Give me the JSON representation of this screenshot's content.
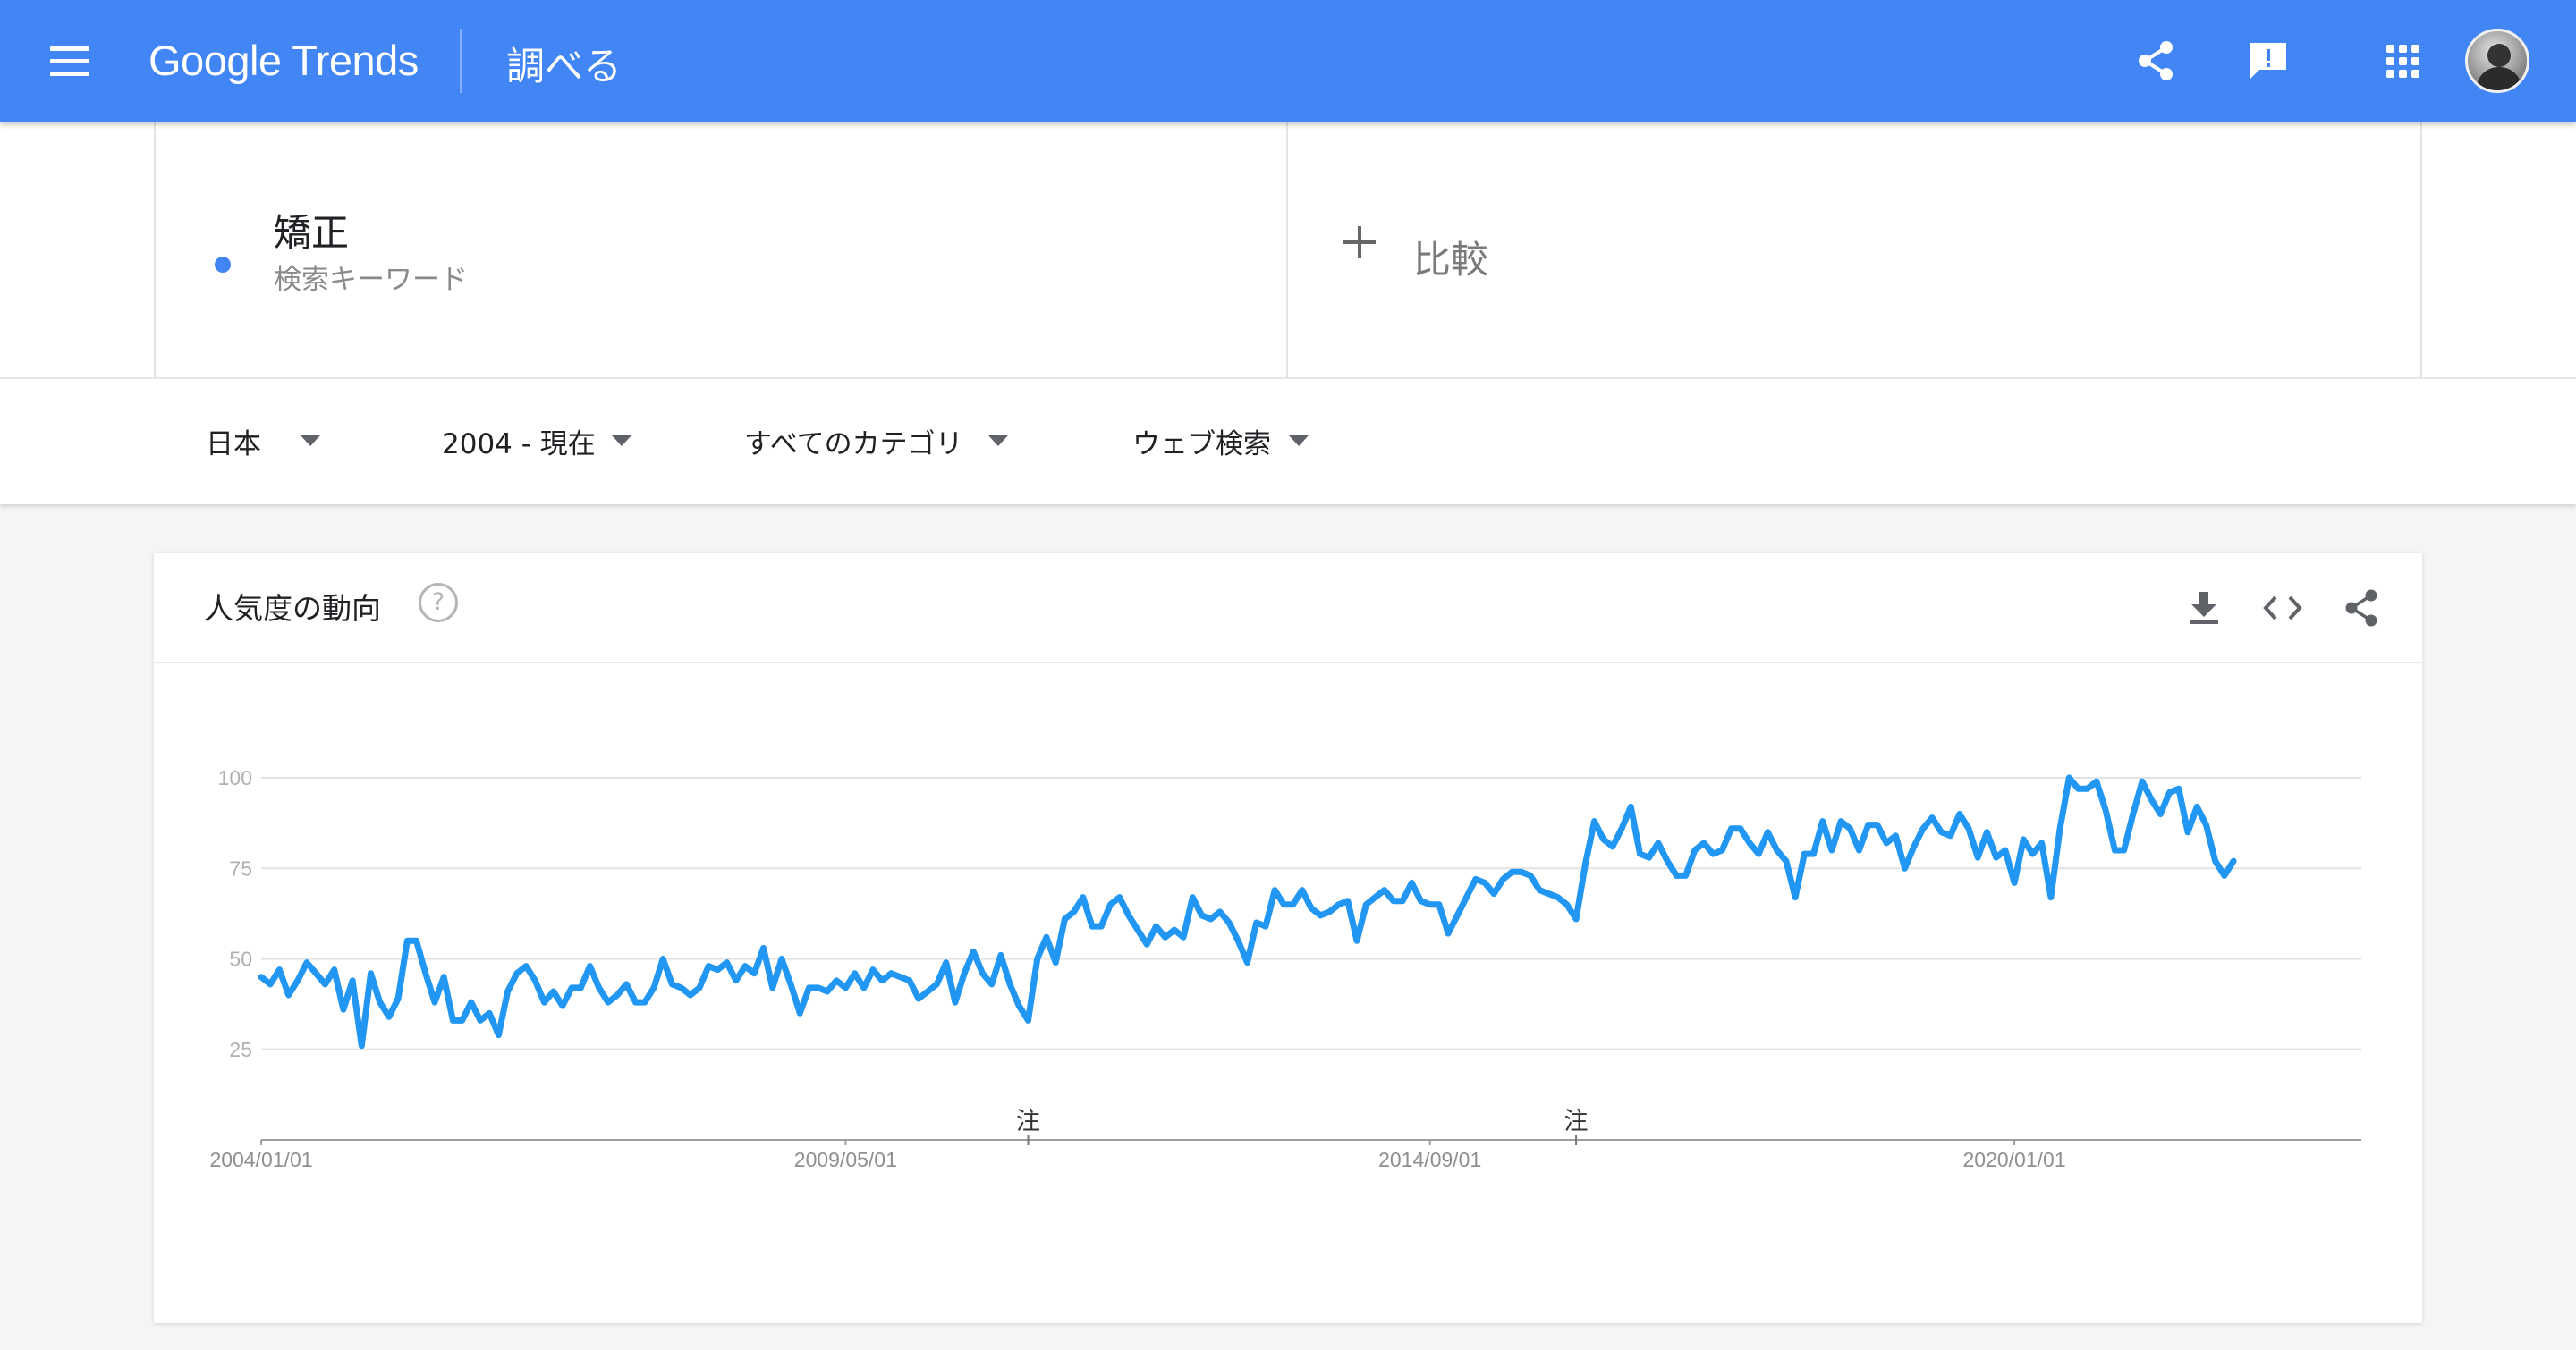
{
  "header": {
    "logo_text": "Google Trends",
    "page_title": "調べる",
    "icons": [
      "menu-icon",
      "share-icon",
      "feedback-icon",
      "apps-icon",
      "account-avatar"
    ],
    "brand_color": "#4285f4"
  },
  "term": {
    "name": "矯正",
    "type": "検索キーワード",
    "color": "#4285f4"
  },
  "compare": {
    "label": "比較"
  },
  "filters": {
    "region": "日本",
    "period": "2004 - 現在",
    "category": "すべてのカテゴリ",
    "search_type": "ウェブ検索"
  },
  "chart_card": {
    "title": "人気度の動向",
    "help_glyph": "?",
    "icons": [
      "download-icon",
      "embed-icon",
      "share-icon"
    ]
  },
  "chart_data": {
    "type": "line",
    "title": "",
    "xlabel": "",
    "ylabel": "",
    "ylim": [
      0,
      100
    ],
    "y_ticks": [
      "100",
      "75",
      "50",
      "25"
    ],
    "x_tick_labels": [
      "2004/01/01",
      "2009/05/01",
      "2014/09/01",
      "2020/01/01"
    ],
    "x_range": [
      "2004-01",
      "2023-03"
    ],
    "annotations": [
      {
        "label": "注",
        "date": "2011-01"
      },
      {
        "label": "注",
        "date": "2016-01"
      }
    ],
    "grid": true,
    "legend": "none",
    "series": [
      {
        "color": "#2196f3",
        "points": [
          [
            "2004-01",
            45
          ],
          [
            "2004-02",
            43
          ],
          [
            "2004-03",
            47
          ],
          [
            "2004-04",
            40
          ],
          [
            "2004-05",
            44
          ],
          [
            "2004-06",
            49
          ],
          [
            "2004-07",
            46
          ],
          [
            "2004-08",
            43
          ],
          [
            "2004-09",
            47
          ],
          [
            "2004-10",
            36
          ],
          [
            "2004-11",
            44
          ],
          [
            "2004-12",
            26
          ],
          [
            "2005-01",
            46
          ],
          [
            "2005-02",
            38
          ],
          [
            "2005-03",
            34
          ],
          [
            "2005-04",
            39
          ],
          [
            "2005-05",
            55
          ],
          [
            "2005-06",
            55
          ],
          [
            "2005-07",
            46
          ],
          [
            "2005-08",
            38
          ],
          [
            "2005-09",
            45
          ],
          [
            "2005-10",
            33
          ],
          [
            "2005-11",
            33
          ],
          [
            "2005-12",
            38
          ],
          [
            "2006-01",
            33
          ],
          [
            "2006-02",
            35
          ],
          [
            "2006-03",
            29
          ],
          [
            "2006-04",
            41
          ],
          [
            "2006-05",
            46
          ],
          [
            "2006-06",
            48
          ],
          [
            "2006-07",
            44
          ],
          [
            "2006-08",
            38
          ],
          [
            "2006-09",
            41
          ],
          [
            "2006-10",
            37
          ],
          [
            "2006-11",
            42
          ],
          [
            "2006-12",
            42
          ],
          [
            "2007-01",
            48
          ],
          [
            "2007-02",
            42
          ],
          [
            "2007-03",
            38
          ],
          [
            "2007-04",
            40
          ],
          [
            "2007-05",
            43
          ],
          [
            "2007-06",
            38
          ],
          [
            "2007-07",
            38
          ],
          [
            "2007-08",
            42
          ],
          [
            "2007-09",
            50
          ],
          [
            "2007-10",
            43
          ],
          [
            "2007-11",
            42
          ],
          [
            "2007-12",
            40
          ],
          [
            "2008-01",
            42
          ],
          [
            "2008-02",
            48
          ],
          [
            "2008-03",
            47
          ],
          [
            "2008-04",
            49
          ],
          [
            "2008-05",
            44
          ],
          [
            "2008-06",
            48
          ],
          [
            "2008-07",
            46
          ],
          [
            "2008-08",
            53
          ],
          [
            "2008-09",
            42
          ],
          [
            "2008-10",
            50
          ],
          [
            "2008-11",
            43
          ],
          [
            "2008-12",
            35
          ],
          [
            "2009-01",
            42
          ],
          [
            "2009-02",
            42
          ],
          [
            "2009-03",
            41
          ],
          [
            "2009-04",
            44
          ],
          [
            "2009-05",
            42
          ],
          [
            "2009-06",
            46
          ],
          [
            "2009-07",
            42
          ],
          [
            "2009-08",
            47
          ],
          [
            "2009-09",
            44
          ],
          [
            "2009-10",
            46
          ],
          [
            "2009-11",
            45
          ],
          [
            "2009-12",
            44
          ],
          [
            "2010-01",
            39
          ],
          [
            "2010-02",
            41
          ],
          [
            "2010-03",
            43
          ],
          [
            "2010-04",
            49
          ],
          [
            "2010-05",
            38
          ],
          [
            "2010-06",
            46
          ],
          [
            "2010-07",
            52
          ],
          [
            "2010-08",
            46
          ],
          [
            "2010-09",
            43
          ],
          [
            "2010-10",
            51
          ],
          [
            "2010-11",
            43
          ],
          [
            "2010-12",
            37
          ],
          [
            "2011-01",
            33
          ],
          [
            "2011-02",
            50
          ],
          [
            "2011-03",
            56
          ],
          [
            "2011-04",
            49
          ],
          [
            "2011-05",
            61
          ],
          [
            "2011-06",
            63
          ],
          [
            "2011-07",
            67
          ],
          [
            "2011-08",
            59
          ],
          [
            "2011-09",
            59
          ],
          [
            "2011-10",
            65
          ],
          [
            "2011-11",
            67
          ],
          [
            "2011-12",
            62
          ],
          [
            "2012-01",
            58
          ],
          [
            "2012-02",
            54
          ],
          [
            "2012-03",
            59
          ],
          [
            "2012-04",
            56
          ],
          [
            "2012-05",
            58
          ],
          [
            "2012-06",
            56
          ],
          [
            "2012-07",
            67
          ],
          [
            "2012-08",
            62
          ],
          [
            "2012-09",
            61
          ],
          [
            "2012-10",
            63
          ],
          [
            "2012-11",
            60
          ],
          [
            "2012-12",
            55
          ],
          [
            "2013-01",
            49
          ],
          [
            "2013-02",
            60
          ],
          [
            "2013-03",
            59
          ],
          [
            "2013-04",
            69
          ],
          [
            "2013-05",
            65
          ],
          [
            "2013-06",
            65
          ],
          [
            "2013-07",
            69
          ],
          [
            "2013-08",
            64
          ],
          [
            "2013-09",
            62
          ],
          [
            "2013-10",
            63
          ],
          [
            "2013-11",
            65
          ],
          [
            "2013-12",
            66
          ],
          [
            "2014-01",
            55
          ],
          [
            "2014-02",
            65
          ],
          [
            "2014-03",
            67
          ],
          [
            "2014-04",
            69
          ],
          [
            "2014-05",
            66
          ],
          [
            "2014-06",
            66
          ],
          [
            "2014-07",
            71
          ],
          [
            "2014-08",
            66
          ],
          [
            "2014-09",
            65
          ],
          [
            "2014-10",
            65
          ],
          [
            "2014-11",
            57
          ],
          [
            "2014-12",
            62
          ],
          [
            "2015-01",
            67
          ],
          [
            "2015-02",
            72
          ],
          [
            "2015-03",
            71
          ],
          [
            "2015-04",
            68
          ],
          [
            "2015-05",
            72
          ],
          [
            "2015-06",
            74
          ],
          [
            "2015-07",
            74
          ],
          [
            "2015-08",
            73
          ],
          [
            "2015-09",
            69
          ],
          [
            "2015-10",
            68
          ],
          [
            "2015-11",
            67
          ],
          [
            "2015-12",
            65
          ],
          [
            "2016-01",
            61
          ],
          [
            "2016-02",
            76
          ],
          [
            "2016-03",
            88
          ],
          [
            "2016-04",
            83
          ],
          [
            "2016-05",
            81
          ],
          [
            "2016-06",
            86
          ],
          [
            "2016-07",
            92
          ],
          [
            "2016-08",
            79
          ],
          [
            "2016-09",
            78
          ],
          [
            "2016-10",
            82
          ],
          [
            "2016-11",
            77
          ],
          [
            "2016-12",
            73
          ],
          [
            "2017-01",
            73
          ],
          [
            "2017-02",
            80
          ],
          [
            "2017-03",
            82
          ],
          [
            "2017-04",
            79
          ],
          [
            "2017-05",
            80
          ],
          [
            "2017-06",
            86
          ],
          [
            "2017-07",
            86
          ],
          [
            "2017-08",
            82
          ],
          [
            "2017-09",
            79
          ],
          [
            "2017-10",
            85
          ],
          [
            "2017-11",
            80
          ],
          [
            "2017-12",
            77
          ],
          [
            "2018-01",
            67
          ],
          [
            "2018-02",
            79
          ],
          [
            "2018-03",
            79
          ],
          [
            "2018-04",
            88
          ],
          [
            "2018-05",
            80
          ],
          [
            "2018-06",
            88
          ],
          [
            "2018-07",
            86
          ],
          [
            "2018-08",
            80
          ],
          [
            "2018-09",
            87
          ],
          [
            "2018-10",
            87
          ],
          [
            "2018-11",
            82
          ],
          [
            "2018-12",
            84
          ],
          [
            "2019-01",
            75
          ],
          [
            "2019-02",
            81
          ],
          [
            "2019-03",
            86
          ],
          [
            "2019-04",
            89
          ],
          [
            "2019-05",
            85
          ],
          [
            "2019-06",
            84
          ],
          [
            "2019-07",
            90
          ],
          [
            "2019-08",
            86
          ],
          [
            "2019-09",
            78
          ],
          [
            "2019-10",
            85
          ],
          [
            "2019-11",
            78
          ],
          [
            "2019-12",
            80
          ],
          [
            "2020-01",
            71
          ],
          [
            "2020-02",
            83
          ],
          [
            "2020-03",
            79
          ],
          [
            "2020-04",
            82
          ],
          [
            "2020-05",
            67
          ],
          [
            "2020-06",
            86
          ],
          [
            "2020-07",
            100
          ],
          [
            "2020-08",
            97
          ],
          [
            "2020-09",
            97
          ],
          [
            "2020-10",
            99
          ],
          [
            "2020-11",
            91
          ],
          [
            "2020-12",
            80
          ],
          [
            "2021-01",
            80
          ],
          [
            "2021-02",
            90
          ],
          [
            "2021-03",
            99
          ],
          [
            "2021-04",
            94
          ],
          [
            "2021-05",
            90
          ],
          [
            "2021-06",
            96
          ],
          [
            "2021-07",
            97
          ],
          [
            "2021-08",
            85
          ],
          [
            "2021-09",
            92
          ],
          [
            "2021-10",
            87
          ],
          [
            "2021-11",
            77
          ],
          [
            "2021-12",
            73
          ],
          [
            "2022-01",
            77
          ]
        ]
      }
    ]
  }
}
